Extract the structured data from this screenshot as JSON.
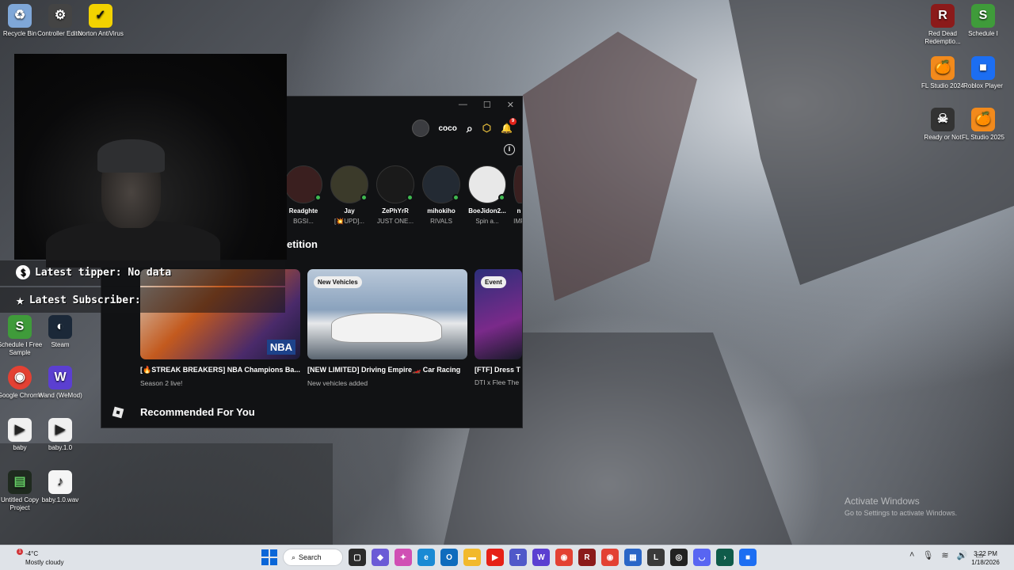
{
  "desktop_left": [
    {
      "label": "Recycle Bin",
      "icon": "recycle-bin-icon",
      "color": "#7fa7d8"
    },
    {
      "label": "Controller Editor",
      "icon": "controller-icon",
      "color": "#444444"
    },
    {
      "label": "Norton AntiVirus",
      "icon": "norton-icon",
      "color": "#f2d200"
    }
  ],
  "desktop_col": [
    {
      "label": "Schedule I Free Sample",
      "icon": "schedule-icon",
      "color": "#3f9b3a"
    },
    {
      "label": "Steam",
      "icon": "steam-icon",
      "color": "#1b2838"
    },
    {
      "label": "Google Chrome",
      "icon": "chrome-icon",
      "color": "#e34133"
    },
    {
      "label": "Wand (WeMod)",
      "icon": "wand-icon",
      "color": "#5b3fd1"
    },
    {
      "label": "baby",
      "icon": "video-file-icon",
      "color": "#f0f0f0"
    },
    {
      "label": "baby.1.0",
      "icon": "video-file-icon",
      "color": "#f0f0f0"
    },
    {
      "label": "Untitled Copy Project",
      "icon": "project-icon",
      "color": "#1f2a1f"
    },
    {
      "label": "baby.1.0.wav",
      "icon": "audio-file-icon",
      "color": "#f5f5f5"
    }
  ],
  "desktop_right": [
    {
      "label": "Red Dead Redemptio...",
      "icon": "red-dead-icon",
      "color": "#8b1a1a"
    },
    {
      "label": "Schedule I",
      "icon": "schedule-icon",
      "color": "#3f9b3a"
    },
    {
      "label": "FL Studio 2024",
      "icon": "fl-studio-icon",
      "color": "#f28a1c"
    },
    {
      "label": "Roblox Player",
      "icon": "roblox-icon",
      "color": "#1c6ef2"
    },
    {
      "label": "Ready or Not",
      "icon": "ready-or-not-icon",
      "color": "#333333"
    },
    {
      "label": "FL Studio 2025",
      "icon": "fl-studio-icon",
      "color": "#f28a1c"
    }
  ],
  "roblox": {
    "username": "coco",
    "notification_count": "9",
    "friends": [
      {
        "name": "Readghte",
        "status": "BGSI..."
      },
      {
        "name": "Jay",
        "status": "[💥UPD]..."
      },
      {
        "name": "ZePhYrR",
        "status": "JUST ONE..."
      },
      {
        "name": "mihokiho",
        "status": "RIVALS"
      },
      {
        "name": "BoeJidon2...",
        "status": "Spin a..."
      },
      {
        "name": "n",
        "status": "IMF"
      }
    ],
    "section_partial": "etition",
    "cards": [
      {
        "badge": "",
        "title": "[🔥STREAK BREAKERS] NBA Champions Ba...",
        "desc": "Season 2 live!",
        "color": "#c35a1e"
      },
      {
        "badge": "New Vehicles",
        "title": "[NEW LIMITED] Driving Empire🏎️ Car Racing",
        "desc": "New vehicles added",
        "color": "#6f8fb0"
      },
      {
        "badge": "Event",
        "title": "[FTF] Dress T",
        "desc": "DTI x Flee The",
        "color": "#2c2f7a"
      }
    ],
    "recommended_title": "Recommended For You"
  },
  "overlay": {
    "tipper": "Latest tipper: No data",
    "subscriber": "Latest Subscriber:"
  },
  "watermark": {
    "title": "Activate Windows",
    "sub": "Go to Settings to activate Windows."
  },
  "taskbar": {
    "temp": "-4°C",
    "weather": "Mostly cloudy",
    "weather_badge": "1",
    "search": "Search",
    "time": "3:22 PM",
    "date": "1/18/2026",
    "apps": [
      {
        "icon": "task-view-icon",
        "color": "#2b2b2b",
        "glyph": "▢"
      },
      {
        "icon": "copilot-icon",
        "color": "#6b5bd6",
        "glyph": "◆"
      },
      {
        "icon": "copilot-app-icon",
        "color": "#d04fb4",
        "glyph": "✦"
      },
      {
        "icon": "edge-icon",
        "color": "#1a8ad4",
        "glyph": "e"
      },
      {
        "icon": "outlook-icon",
        "color": "#0f6cbd",
        "glyph": "O"
      },
      {
        "icon": "file-explorer-icon",
        "color": "#f2b92c",
        "glyph": "▬"
      },
      {
        "icon": "youtube-icon",
        "color": "#e62117",
        "glyph": "▶"
      },
      {
        "icon": "teams-icon",
        "color": "#5059c9",
        "glyph": "T"
      },
      {
        "icon": "wand-icon",
        "color": "#5b3fd1",
        "glyph": "W"
      },
      {
        "icon": "chrome-icon",
        "color": "#e34133",
        "glyph": "◉"
      },
      {
        "icon": "red-dead-icon",
        "color": "#8b1a1a",
        "glyph": "R"
      },
      {
        "icon": "chrome-profile-icon",
        "color": "#e34133",
        "glyph": "◉"
      },
      {
        "icon": "store-icon",
        "color": "#2a66c7",
        "glyph": "▦"
      },
      {
        "icon": "live-icon",
        "color": "#3a3a3a",
        "glyph": "L"
      },
      {
        "icon": "obs-icon",
        "color": "#222222",
        "glyph": "◎"
      },
      {
        "icon": "discord-icon",
        "color": "#5865f2",
        "glyph": "◡"
      },
      {
        "icon": "terminal-icon",
        "color": "#0f5b4a",
        "glyph": "›"
      },
      {
        "icon": "roblox-icon",
        "color": "#1c6ef2",
        "glyph": "■"
      }
    ]
  }
}
